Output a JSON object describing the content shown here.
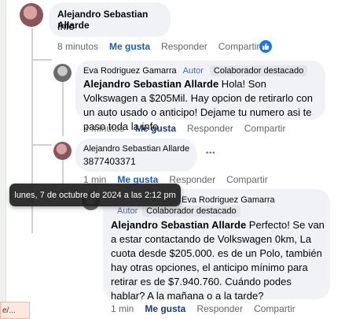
{
  "comments": [
    {
      "author": "Alejandro Sebastian Allarde",
      "text": "Info",
      "time": "8 minutos",
      "like": "Me gusta",
      "reply": "Responder",
      "share": "Compartir"
    },
    {
      "author": "Eva Rodriguez Gamarra",
      "badge_author": "Autor",
      "badge_collab": "Colaborador destacado",
      "mention": "Alejandro Sebastian Allarde",
      "text": " Hola! Son Volkswagen a $205Mil. Hay opcion de retirarlo con un auto usado o anticipo! Dejame tu numero asi te paso toda la info",
      "time": "3 minutos",
      "like": "Me gusta",
      "reply": "Responder",
      "share": "Compartir"
    },
    {
      "author": "Alejandro Sebastian Allarde",
      "text": "3877403371",
      "more": "•••",
      "time": "1 min",
      "like": "Me gusta",
      "reply": "Responder",
      "share": "Compartir"
    },
    {
      "author": "Eva Rodriguez Gamarra",
      "badge_author": "Autor",
      "badge_collab": "Colaborador destacado",
      "mention": "Alejandro Sebastian Allarde",
      "text": " Perfecto! Se van a estar contactando de Volkswagen 0km, La cuota desde $205.000. es de un Polo, también hay otras opciones, el anticipo mínimo para retirar es de $7.940.760. Cuándo podes hablar? A la mañana o a la tarde?",
      "time": "1 min",
      "like": "Me gusta",
      "reply": "Responder",
      "share": "Compartir"
    }
  ],
  "tooltip": "lunes, 7 de octubre de 2024 a las 2:12 pm",
  "url_chip": "e/...",
  "colors": {
    "like_blue": "#1b5fb8",
    "bubble": "#f0f2f5",
    "meta": "#65676b"
  }
}
